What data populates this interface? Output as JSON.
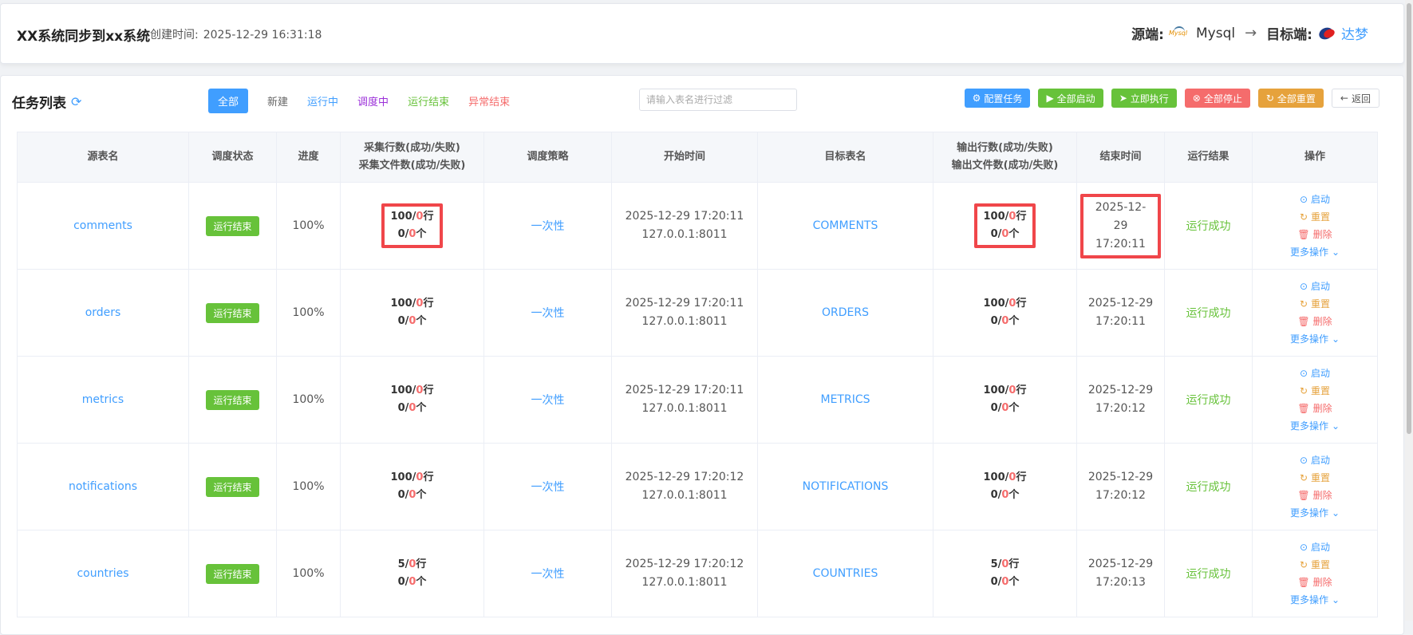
{
  "header": {
    "title": "XX系统同步到xx系统",
    "created_label": "创建时间:",
    "created_value": "2025-12-29 16:31:18",
    "source_label": "源端:",
    "source_logo": "Mysql",
    "source_value": "Mysql",
    "arrow": "→",
    "target_label": "目标端:",
    "target_value": "达梦"
  },
  "list": {
    "title": "任务列表",
    "filters": [
      "全部",
      "新建",
      "运行中",
      "调度中",
      "运行结束",
      "异常结束"
    ],
    "search_placeholder": "请输入表名进行过滤",
    "buttons": {
      "config": "配置任务",
      "start_all": "全部启动",
      "run_now": "立即执行",
      "stop_all": "全部停止",
      "reset_all": "全部重置",
      "back": "返回"
    }
  },
  "table": {
    "headers": {
      "source": "源表名",
      "status": "调度状态",
      "progress": "进度",
      "collect_rows": "采集行数(成功/失败)",
      "collect_files": "采集文件数(成功/失败)",
      "strategy": "调度策略",
      "start_time": "开始时间",
      "target": "目标表名",
      "out_rows": "输出行数(成功/失败)",
      "out_files": "输出文件数(成功/失败)",
      "end_time": "结束时间",
      "result": "运行结果",
      "ops": "操作"
    },
    "ops_labels": {
      "start": "启动",
      "reset": "重置",
      "delete": "删除",
      "more": "更多操作"
    },
    "rows": [
      {
        "source": "comments",
        "status": "运行结束",
        "progress": "100%",
        "c_ok": "100",
        "c_fail": "0",
        "c_unit": "行",
        "f_ok": "0",
        "f_fail": "0",
        "f_unit": "个",
        "strategy": "一次性",
        "start": "2025-12-29 17:20:11",
        "host": "127.0.0.1:8011",
        "target": "COMMENTS",
        "o_ok": "100",
        "o_fail": "0",
        "o_unit": "行",
        "of_ok": "0",
        "of_fail": "0",
        "of_unit": "个",
        "end_date": "2025-12-29",
        "end_time": "17:20:11",
        "result": "运行成功"
      },
      {
        "source": "orders",
        "status": "运行结束",
        "progress": "100%",
        "c_ok": "100",
        "c_fail": "0",
        "c_unit": "行",
        "f_ok": "0",
        "f_fail": "0",
        "f_unit": "个",
        "strategy": "一次性",
        "start": "2025-12-29 17:20:11",
        "host": "127.0.0.1:8011",
        "target": "ORDERS",
        "o_ok": "100",
        "o_fail": "0",
        "o_unit": "行",
        "of_ok": "0",
        "of_fail": "0",
        "of_unit": "个",
        "end_date": "2025-12-29",
        "end_time": "17:20:11",
        "result": "运行成功"
      },
      {
        "source": "metrics",
        "status": "运行结束",
        "progress": "100%",
        "c_ok": "100",
        "c_fail": "0",
        "c_unit": "行",
        "f_ok": "0",
        "f_fail": "0",
        "f_unit": "个",
        "strategy": "一次性",
        "start": "2025-12-29 17:20:11",
        "host": "127.0.0.1:8011",
        "target": "METRICS",
        "o_ok": "100",
        "o_fail": "0",
        "o_unit": "行",
        "of_ok": "0",
        "of_fail": "0",
        "of_unit": "个",
        "end_date": "2025-12-29",
        "end_time": "17:20:12",
        "result": "运行成功"
      },
      {
        "source": "notifications",
        "status": "运行结束",
        "progress": "100%",
        "c_ok": "100",
        "c_fail": "0",
        "c_unit": "行",
        "f_ok": "0",
        "f_fail": "0",
        "f_unit": "个",
        "strategy": "一次性",
        "start": "2025-12-29 17:20:12",
        "host": "127.0.0.1:8011",
        "target": "NOTIFICATIONS",
        "o_ok": "100",
        "o_fail": "0",
        "o_unit": "行",
        "of_ok": "0",
        "of_fail": "0",
        "of_unit": "个",
        "end_date": "2025-12-29",
        "end_time": "17:20:12",
        "result": "运行成功"
      },
      {
        "source": "countries",
        "status": "运行结束",
        "progress": "100%",
        "c_ok": "5",
        "c_fail": "0",
        "c_unit": "行",
        "f_ok": "0",
        "f_fail": "0",
        "f_unit": "个",
        "strategy": "一次性",
        "start": "2025-12-29 17:20:12",
        "host": "127.0.0.1:8011",
        "target": "COUNTRIES",
        "o_ok": "5",
        "o_fail": "0",
        "o_unit": "行",
        "of_ok": "0",
        "of_fail": "0",
        "of_unit": "个",
        "end_date": "2025-12-29",
        "end_time": "17:20:13",
        "result": "运行成功"
      }
    ]
  }
}
